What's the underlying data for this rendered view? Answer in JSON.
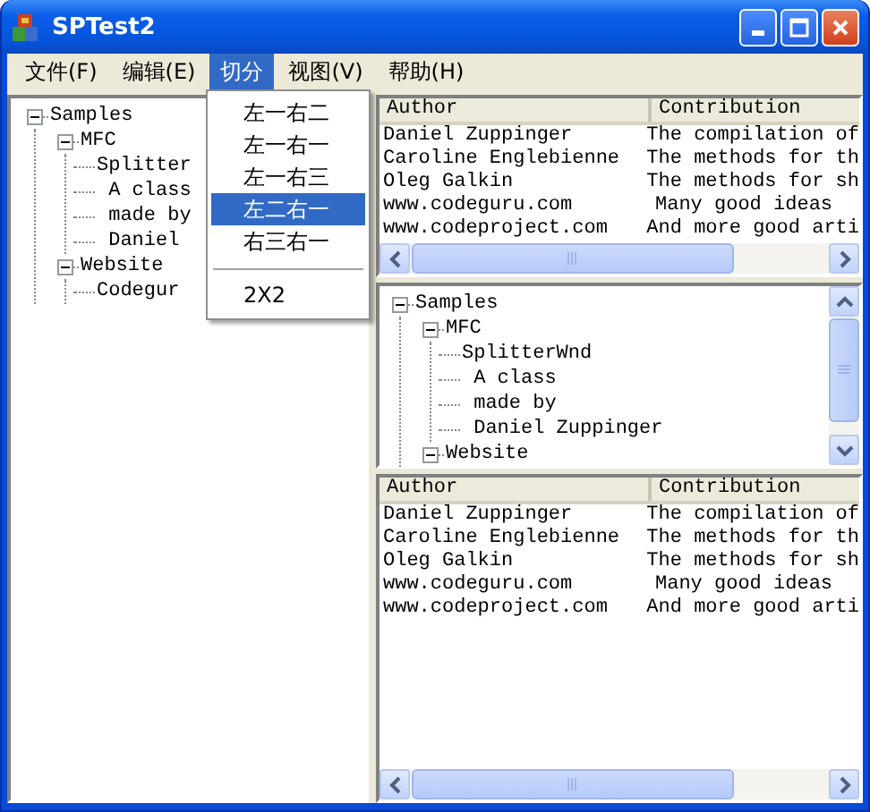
{
  "window": {
    "title": "SPTest2"
  },
  "menu_bar": [
    {
      "label": "文件(F)",
      "selected": false
    },
    {
      "label": "编辑(E)",
      "selected": false
    },
    {
      "label": "切分",
      "selected": true
    },
    {
      "label": "视图(V)",
      "selected": false
    },
    {
      "label": "帮助(H)",
      "selected": false
    }
  ],
  "menu_popup": {
    "items": [
      {
        "kind": "item",
        "label": "左一右二",
        "selected": false
      },
      {
        "kind": "item",
        "label": "左一右一",
        "selected": false
      },
      {
        "kind": "item",
        "label": "左一右三",
        "selected": false
      },
      {
        "kind": "item",
        "label": "左二右一",
        "selected": true
      },
      {
        "kind": "item",
        "label": "右三右一",
        "selected": false
      },
      {
        "kind": "separator"
      },
      {
        "kind": "item",
        "label": "2X2",
        "selected": false
      }
    ]
  },
  "left_tree": {
    "items": [
      {
        "label": "Samples",
        "expanded": true,
        "children": [
          {
            "label": "MFC",
            "expanded": true,
            "children": [
              {
                "label": "Splitter"
              },
              {
                "label": " A class"
              },
              {
                "label": " made by"
              },
              {
                "label": " Daniel"
              }
            ]
          },
          {
            "label": "Website",
            "expanded": true,
            "children": [
              {
                "label": "Codegur"
              }
            ]
          }
        ]
      }
    ]
  },
  "top_list": {
    "columns": [
      "Author",
      "Contribution"
    ],
    "rows": [
      [
        "Daniel Zuppinger",
        "The compilation of"
      ],
      [
        "Caroline Englebienne",
        "The methods for th"
      ],
      [
        "Oleg Galkin",
        "The methods for sh"
      ],
      [
        "www.codeguru.com",
        "Many good ideas"
      ],
      [
        "www.codeproject.com",
        "And more good arti"
      ]
    ]
  },
  "middle_tree": {
    "items": [
      {
        "label": "Samples",
        "expanded": true,
        "children": [
          {
            "label": "MFC",
            "expanded": true,
            "children": [
              {
                "label": "SplitterWnd"
              },
              {
                "label": " A class"
              },
              {
                "label": " made by"
              },
              {
                "label": " Daniel Zuppinger"
              }
            ]
          },
          {
            "label": "Website",
            "expanded": true
          }
        ]
      }
    ]
  },
  "bottom_list": {
    "columns": [
      "Author",
      "Contribution"
    ],
    "rows": [
      [
        "Daniel Zuppinger",
        "The compilation of"
      ],
      [
        "Caroline Englebienne",
        "The methods for th"
      ],
      [
        "Oleg Galkin",
        "The methods for sh"
      ],
      [
        "www.codeguru.com",
        "Many good ideas"
      ],
      [
        "www.codeproject.com",
        "And more good arti"
      ]
    ]
  }
}
